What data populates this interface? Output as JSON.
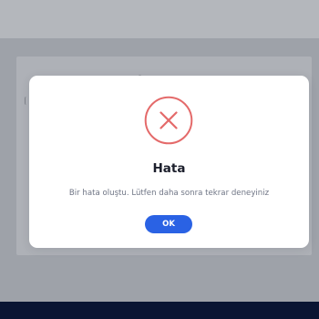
{
  "modal": {
    "title": "Hata",
    "message": "Bir hata oluştu. Lütfen daha sonra tekrar deneyiniz",
    "ok_label": "OK",
    "icon": "error-x-circle-icon"
  },
  "colors": {
    "error_icon": "#e46a6a",
    "button": "#2a62e4",
    "title": "#1c1f2c",
    "message": "#6f7585",
    "overlay": "#9ea2a9",
    "footer": "#0a1533"
  }
}
